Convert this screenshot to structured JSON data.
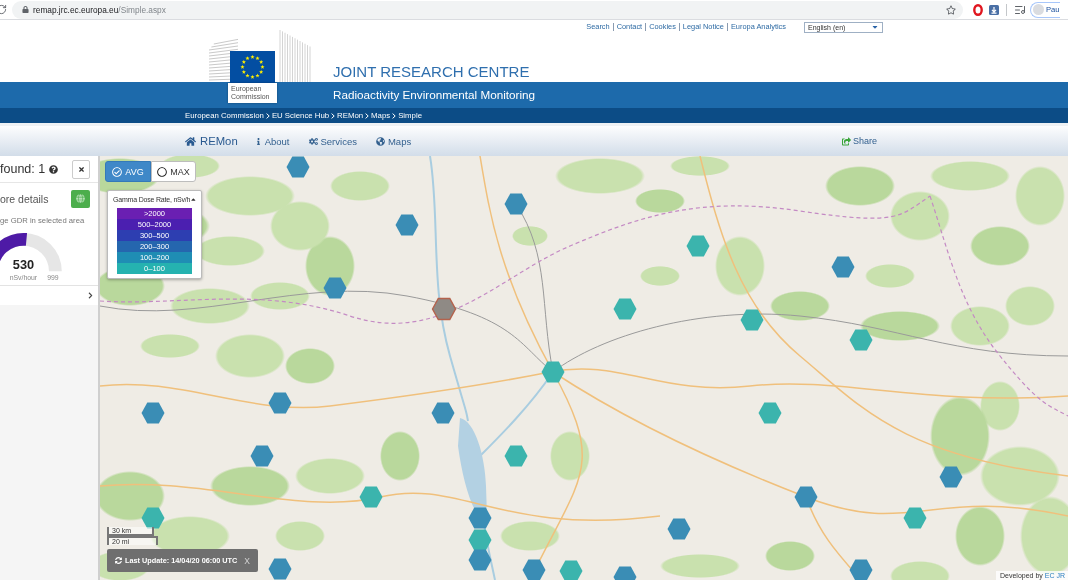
{
  "browser": {
    "url_host": "remap.jrc.ec.europa.eu",
    "url_path": "/Simple.aspx",
    "profile": "Pau"
  },
  "header": {
    "top_links": [
      "Search",
      "Contact",
      "Cookies",
      "Legal Notice",
      "Europa Analytics"
    ],
    "language": "English (en)",
    "logo_label": "European Commission",
    "title": "JOINT RESEARCH CENTRE",
    "subtitle": "Radioactivity Environmental Monitoring",
    "breadcrumb": [
      "European Commission",
      "EU Science Hub",
      "REMon",
      "Maps",
      "Simple"
    ]
  },
  "nav": {
    "brand": "REMon",
    "items": [
      {
        "kind": "info",
        "label": "About"
      },
      {
        "kind": "services",
        "label": "Services"
      },
      {
        "kind": "maps",
        "label": "Maps"
      }
    ],
    "share": "Share"
  },
  "results_panel": {
    "found": "found: 1",
    "details": "ore details",
    "caption": "ge GDR in selected area",
    "gauge": {
      "value": "530",
      "unit": "nSv/hour",
      "max": "999",
      "level": 0.53
    }
  },
  "map": {
    "mode_toggle": [
      {
        "label": "AVG",
        "selected": true
      },
      {
        "label": "MAX",
        "selected": false
      }
    ],
    "legend": {
      "title": "Gamma Dose Rate, nSv/h",
      "expanded": true,
      "ranges": [
        {
          "label": ">2000",
          "color": "#6a1fb2"
        },
        {
          "label": "500–2000",
          "color": "#4b1fb0"
        },
        {
          "label": "300–500",
          "color": "#2d3eb1"
        },
        {
          "label": "200–300",
          "color": "#2566ae"
        },
        {
          "label": "100–200",
          "color": "#1f8db4"
        },
        {
          "label": "0–100",
          "color": "#25b2b0"
        }
      ]
    },
    "stations": [
      {
        "color": "#3a8db5",
        "selected": false
      },
      {
        "color": "#3a8db5",
        "selected": false
      },
      {
        "color": "#3a8db5",
        "selected": false
      },
      {
        "color": "#3bb4ad",
        "selected": false
      },
      {
        "color": "#3a8db5",
        "selected": false
      },
      {
        "color": "#3a8db5",
        "selected": false
      },
      {
        "color": "#8f8a85",
        "selected": true
      },
      {
        "color": "#3bb4ad",
        "selected": false
      },
      {
        "color": "#3bb4ad",
        "selected": false
      },
      {
        "color": "#3bb4ad",
        "selected": false
      },
      {
        "color": "#3bb4ad",
        "selected": false
      },
      {
        "color": "#3a8db5",
        "selected": false
      },
      {
        "color": "#3a8db5",
        "selected": false
      },
      {
        "color": "#3a8db5",
        "selected": false
      },
      {
        "color": "#3bb4ad",
        "selected": false
      },
      {
        "color": "#3a8db5",
        "selected": false
      },
      {
        "color": "#3bb4ad",
        "selected": false
      },
      {
        "color": "#3a8db5",
        "selected": false
      },
      {
        "color": "#3bb4ad",
        "selected": false
      },
      {
        "color": "#3a8db5",
        "selected": false
      },
      {
        "color": "#3bb4ad",
        "selected": false
      },
      {
        "color": "#3a8db5",
        "selected": false
      },
      {
        "color": "#3bb4ad",
        "selected": false
      },
      {
        "color": "#3a8db5",
        "selected": false
      },
      {
        "color": "#3bb4ad",
        "selected": false
      },
      {
        "color": "#3a8db5",
        "selected": false
      },
      {
        "color": "#3a8db5",
        "selected": false
      },
      {
        "color": "#3a8db5",
        "selected": false
      },
      {
        "color": "#3bb4ad",
        "selected": false
      },
      {
        "color": "#3a8db5",
        "selected": false
      },
      {
        "color": "#3a8db5",
        "selected": false
      }
    ],
    "scale": [
      "30 km",
      "20 mi"
    ],
    "last_update": "Last Update: 14/04/20 06:00 UTC",
    "dismiss": "X",
    "attribution": {
      "text": "Developed by",
      "link": "EC JR"
    }
  }
}
